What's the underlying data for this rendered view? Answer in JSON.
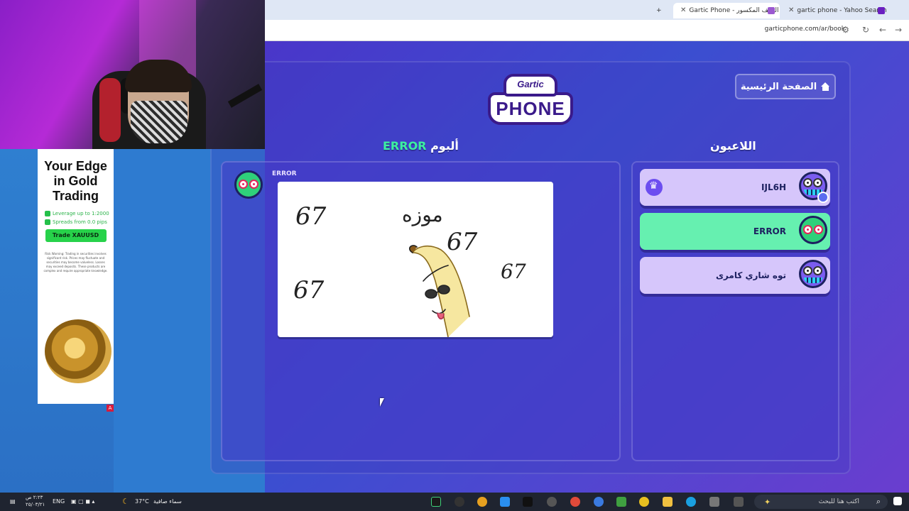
{
  "browser": {
    "tabs": [
      {
        "label": "Gartic Phone - الهاتف المكسور"
      },
      {
        "label": "gartic phone - Yahoo Search Re"
      }
    ],
    "url": "garticphone.com/ar/book"
  },
  "ad": {
    "title": "Your Edge in Gold Trading",
    "bullets": [
      "Leverage up to 1:2000",
      "Spreads from 0.0 pips"
    ],
    "cta": "Trade XAUUSD",
    "disclaimer": "Risk Warning: Trading in securities involves significant risk. Prices may fluctuate and securities may become valueless. Losses may exceed deposits. These products are complex and require appropriate knowledge.",
    "badge": "A"
  },
  "game": {
    "logo_top": "Gartic",
    "logo_bottom": "PHONE",
    "home_button": "الصفحة الرئيسية",
    "album_heading_prefix": "ألبوم",
    "album_heading_name": "ERROR",
    "players_heading": "اللاعبون",
    "album_author": "ERROR",
    "drawing_texts": [
      "67",
      "موزه",
      "67",
      "67",
      "67"
    ],
    "players": [
      {
        "name": "IJL6H",
        "host": true
      },
      {
        "name": "ERROR",
        "active": true
      },
      {
        "name": "توه شاري كامرى"
      }
    ]
  },
  "taskbar": {
    "weather_temp": "37°C",
    "weather_desc": "سماء صافية",
    "language": "ENG",
    "time": "٢:٢٣ ص",
    "date": "٢٥/٠٣/٢١",
    "search_placeholder": "اكتب هنا للبحث"
  }
}
